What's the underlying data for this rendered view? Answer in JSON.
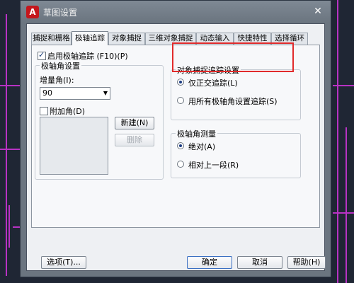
{
  "window": {
    "title": "草图设置",
    "app_icon_letter": "A",
    "close_symbol": "✕"
  },
  "tabs": [
    {
      "label": "捕捉和栅格",
      "active": false
    },
    {
      "label": "极轴追踪",
      "active": true
    },
    {
      "label": "对象捕捉",
      "active": false
    },
    {
      "label": "三维对象捕捉",
      "active": false
    },
    {
      "label": "动态输入",
      "active": false
    },
    {
      "label": "快捷特性",
      "active": false
    },
    {
      "label": "选择循环",
      "active": false
    }
  ],
  "polar": {
    "enable_label": "启用极轴追踪 (F10)(P)",
    "enable_checked": true,
    "angle_settings": {
      "title": "极轴角设置",
      "increment_label": "增量角(I):",
      "increment_value": "90",
      "additional_label": "附加角(D)",
      "additional_checked": false,
      "new_button": "新建(N)",
      "delete_button": "删除"
    },
    "object_snap_tracking": {
      "title": "对象捕捉追踪设置",
      "option_orthogonal": "仅正交追踪(L)",
      "option_all_polar": "用所有极轴角设置追踪(S)",
      "selected": "orthogonal"
    },
    "polar_measurement": {
      "title": "极轴角测量",
      "option_absolute": "绝对(A)",
      "option_relative": "相对上一段(R)",
      "selected": "absolute"
    }
  },
  "footer": {
    "options_button": "选项(T)...",
    "ok_button": "确定",
    "cancel_button": "取消",
    "help_button": "帮助(H)"
  },
  "colors": {
    "highlight_box": "#e12b2b",
    "cad_lines": "#b832c4"
  }
}
